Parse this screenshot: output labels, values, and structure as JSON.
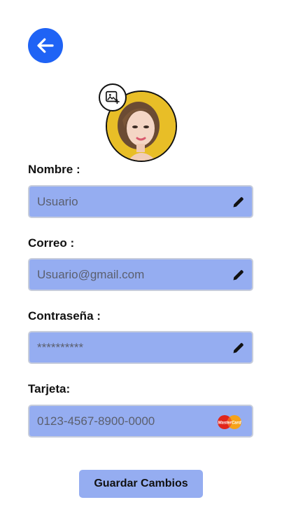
{
  "header": {
    "back_icon": "arrow-left-icon",
    "back_color": "#1f63f5"
  },
  "profile": {
    "avatar_icon": "profile-photo",
    "change_photo_icon": "add-image-icon"
  },
  "form": {
    "name": {
      "label": "Nombre :",
      "value": "Usuario",
      "icon": "pencil-icon"
    },
    "email": {
      "label": "Correo :",
      "value": "Usuario@gmail.com",
      "icon": "pencil-icon"
    },
    "password": {
      "label": "Contraseña :",
      "value": "**********",
      "icon": "pencil-icon"
    },
    "card": {
      "label": "Tarjeta:",
      "value": "0123-4567-8900-0000",
      "icon": "mastercard-icon",
      "card_brand": "MasterCard"
    }
  },
  "actions": {
    "save_label": "Guardar Cambios"
  },
  "colors": {
    "field_bg": "#95adf1",
    "accent": "#1f63f5"
  }
}
